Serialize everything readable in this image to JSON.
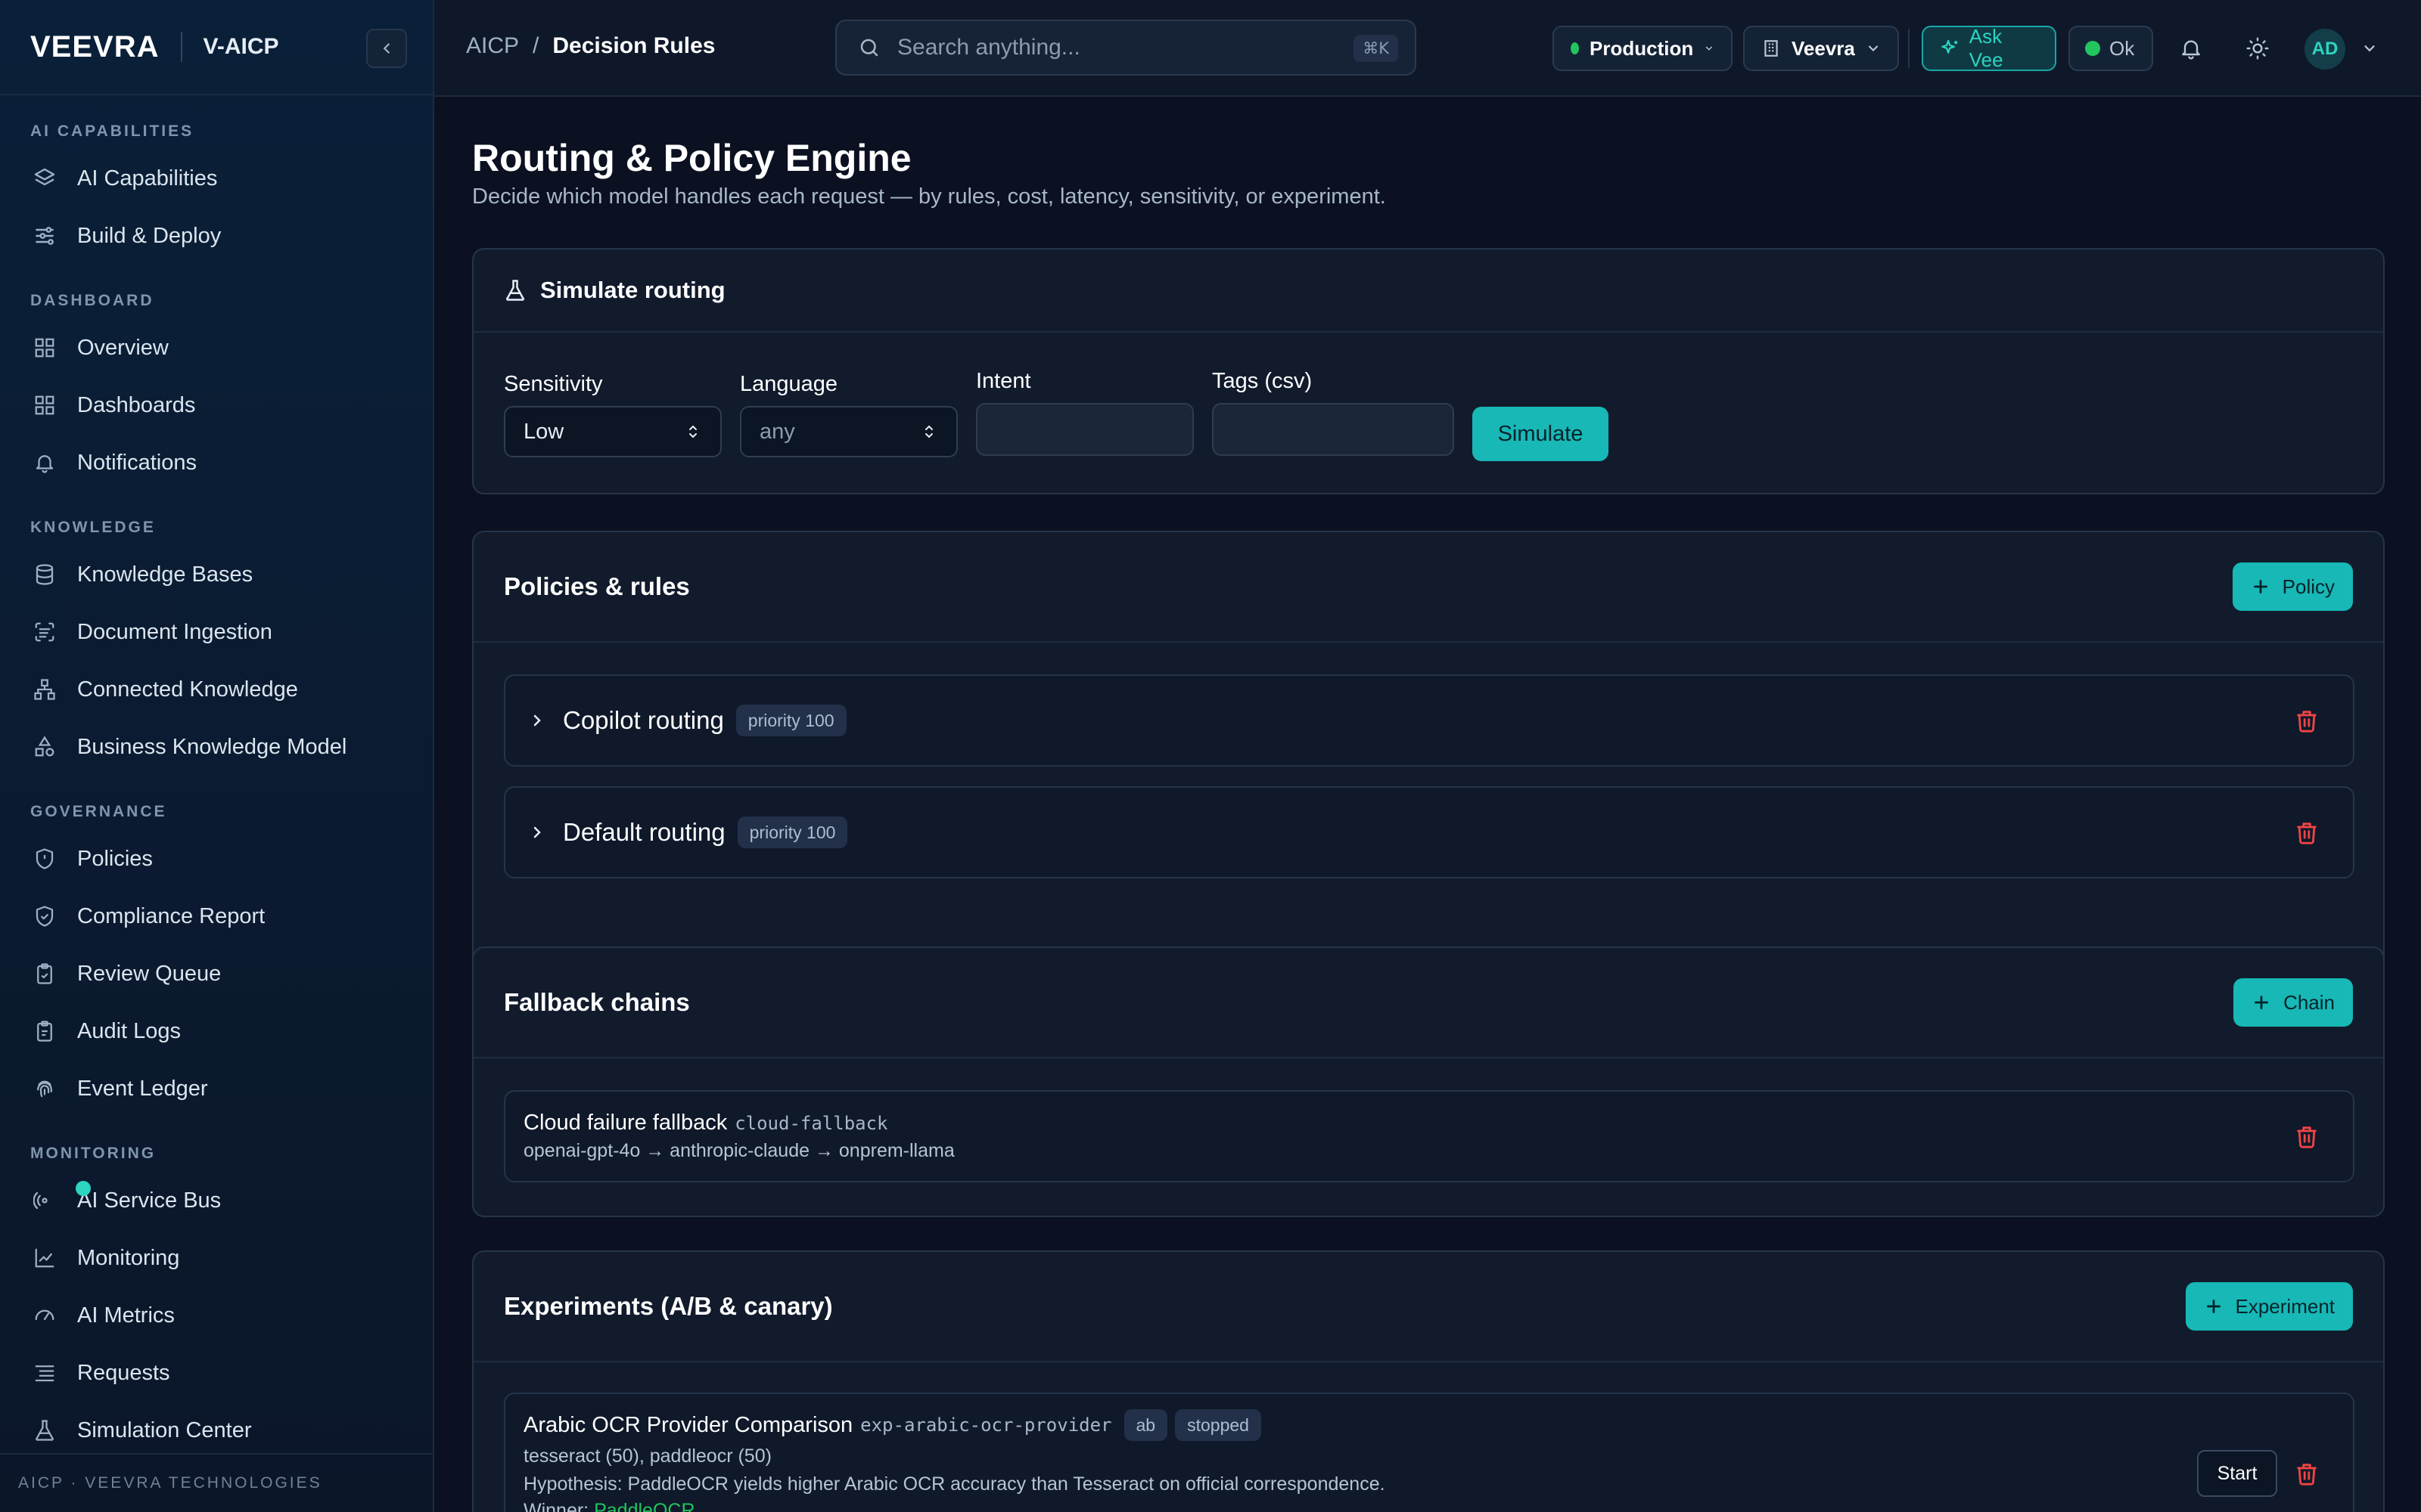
{
  "sidebar": {
    "logo": "VEEVRA",
    "product": "V-AICP",
    "sections": [
      {
        "title": "AI CAPABILITIES",
        "items": [
          {
            "label": "AI Capabilities",
            "icon": "layers-icon"
          },
          {
            "label": "Build & Deploy",
            "icon": "sliders-icon"
          }
        ]
      },
      {
        "title": "DASHBOARD",
        "items": [
          {
            "label": "Overview",
            "icon": "grid-icon"
          },
          {
            "label": "Dashboards",
            "icon": "grid-icon"
          },
          {
            "label": "Notifications",
            "icon": "bell-icon"
          }
        ]
      },
      {
        "title": "KNOWLEDGE",
        "items": [
          {
            "label": "Knowledge Bases",
            "icon": "database-icon"
          },
          {
            "label": "Document Ingestion",
            "icon": "scan-text-icon"
          },
          {
            "label": "Connected Knowledge",
            "icon": "network-icon"
          },
          {
            "label": "Business Knowledge Model",
            "icon": "shapes-icon"
          }
        ]
      },
      {
        "title": "GOVERNANCE",
        "items": [
          {
            "label": "Policies",
            "icon": "shield-icon"
          },
          {
            "label": "Compliance Report",
            "icon": "shield-check-icon"
          },
          {
            "label": "Review Queue",
            "icon": "clipboard-check-icon"
          },
          {
            "label": "Audit Logs",
            "icon": "clipboard-icon"
          },
          {
            "label": "Event Ledger",
            "icon": "fingerprint-icon"
          }
        ]
      },
      {
        "title": "MONITORING",
        "items": [
          {
            "label": "AI Service Bus",
            "icon": "radio-icon"
          },
          {
            "label": "Monitoring",
            "icon": "line-chart-icon"
          },
          {
            "label": "AI Metrics",
            "icon": "gauge-icon"
          },
          {
            "label": "Requests",
            "icon": "list-icon"
          },
          {
            "label": "Simulation Center",
            "icon": "flask-icon"
          }
        ]
      }
    ],
    "footer": "AICP · VEEVRA TECHNOLOGIES"
  },
  "topbar": {
    "breadcrumb_root": "AICP",
    "breadcrumb_sep": "/",
    "breadcrumb_current": "Decision Rules",
    "search_placeholder": "Search anything...",
    "search_shortcut": "⌘K",
    "environment": "Production",
    "org": "Veevra",
    "ask_label": "Ask Vee",
    "status_label": "Ok",
    "avatar_initials": "AD"
  },
  "page": {
    "title": "Routing & Policy Engine",
    "subtitle": "Decide which model handles each request — by rules, cost, latency, sensitivity, or experiment."
  },
  "simulate": {
    "title": "Simulate routing",
    "sensitivity_label": "Sensitivity",
    "sensitivity_value": "Low",
    "language_label": "Language",
    "language_value": "any",
    "intent_label": "Intent",
    "tags_label": "Tags (csv)",
    "button": "Simulate"
  },
  "policies": {
    "title": "Policies & rules",
    "add_button": "Policy",
    "items": [
      {
        "name": "Copilot routing",
        "priority": "priority 100"
      },
      {
        "name": "Default routing",
        "priority": "priority 100"
      }
    ]
  },
  "fallback": {
    "title": "Fallback chains",
    "add_button": "Chain",
    "items": [
      {
        "name": "Cloud failure fallback",
        "slug": "cloud-fallback",
        "chain": "openai-gpt-4o → anthropic-claude → onprem-llama"
      }
    ]
  },
  "experiments": {
    "title": "Experiments (A/B & canary)",
    "add_button": "Experiment",
    "items": [
      {
        "name": "Arabic OCR Provider Comparison",
        "slug": "exp-arabic-ocr-provider",
        "type": "ab",
        "status": "stopped",
        "split": "tesseract (50), paddleocr (50)",
        "hypothesis": "Hypothesis: PaddleOCR yields higher Arabic OCR accuracy than Tesseract on official correspondence.",
        "winner_label": "Winner:",
        "winner": "PaddleOCR",
        "action": "Start"
      }
    ]
  },
  "colors": {
    "accent": "#17b8b6",
    "danger": "#ef4444",
    "ok": "#22c55e"
  }
}
